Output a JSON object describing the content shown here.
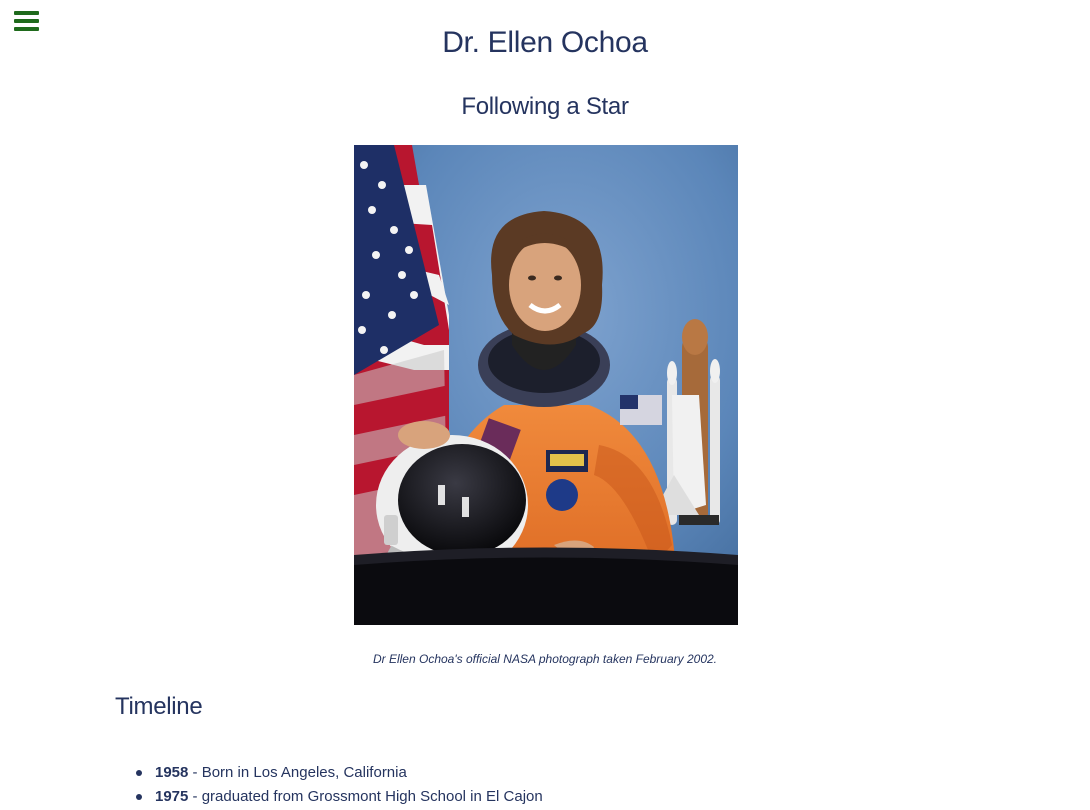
{
  "menu": {
    "icon": "hamburger-menu-icon",
    "color": "#1f6a1c"
  },
  "header": {
    "title": "Dr. Ellen Ochoa",
    "subtitle": "Following a Star"
  },
  "portrait": {
    "alt": "Dr Ellen Ochoa in an orange NASA flight suit with helmet, US flag and space shuttle model",
    "caption": "Dr Ellen Ochoa's official NASA photograph taken February 2002."
  },
  "timeline": {
    "heading": "Timeline",
    "items": [
      {
        "year": "1958",
        "text": " - Born in Los Angeles, California"
      },
      {
        "year": "1975",
        "text": " - graduated from Grossmont High School in El Cajon"
      }
    ]
  },
  "colors": {
    "text": "#25345f",
    "menu": "#1f6a1c",
    "background": "#ffffff"
  }
}
